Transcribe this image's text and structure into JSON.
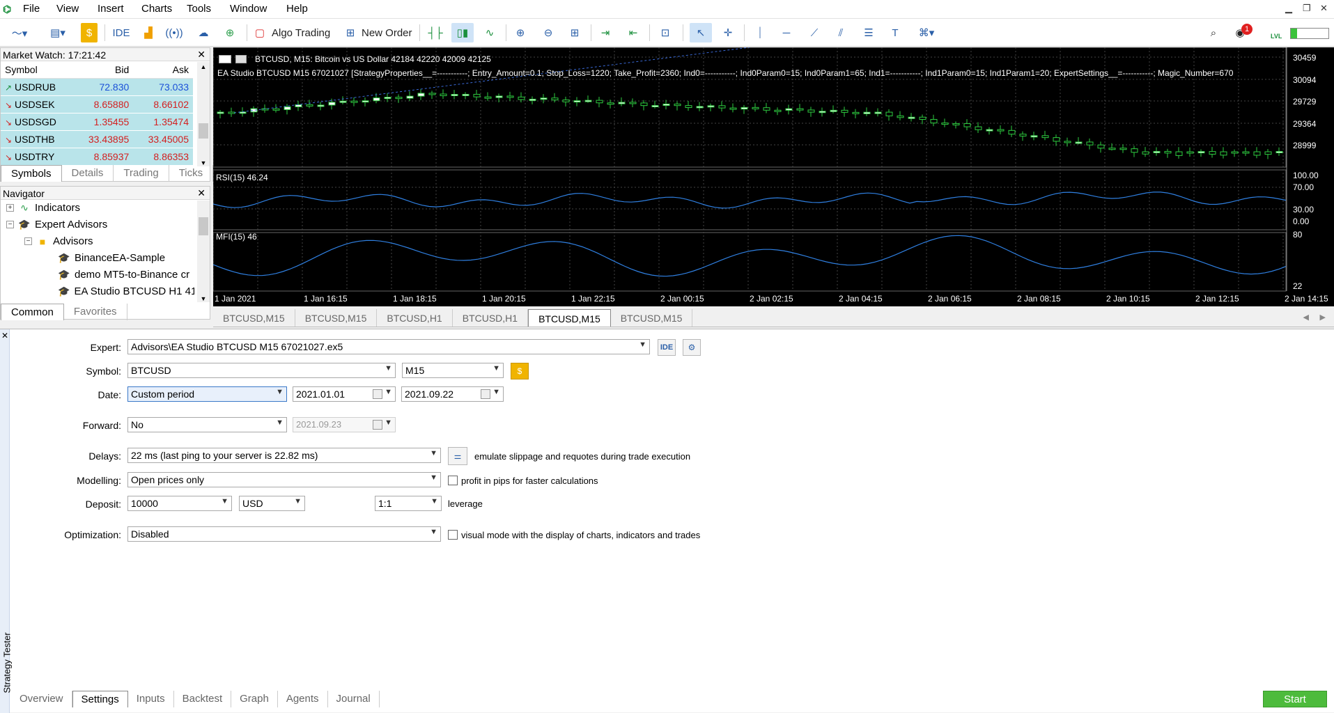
{
  "menu": [
    "File",
    "View",
    "Insert",
    "Charts",
    "Tools",
    "Window",
    "Help"
  ],
  "toolbar": {
    "ide_label": "IDE",
    "algo_trading": "Algo Trading",
    "new_order": "New Order",
    "notification_count": "1",
    "lvl_label": "LVL"
  },
  "market_watch": {
    "title": "Market Watch: 17:21:42",
    "columns": [
      "Symbol",
      "Bid",
      "Ask"
    ],
    "rows": [
      {
        "symbol": "USDRUB",
        "bid": "72.830",
        "ask": "73.033",
        "dir": "up"
      },
      {
        "symbol": "USDSEK",
        "bid": "8.65880",
        "ask": "8.66102",
        "dir": "dn"
      },
      {
        "symbol": "USDSGD",
        "bid": "1.35455",
        "ask": "1.35474",
        "dir": "dn"
      },
      {
        "symbol": "USDTHB",
        "bid": "33.43895",
        "ask": "33.45005",
        "dir": "dn"
      },
      {
        "symbol": "USDTRY",
        "bid": "8.85937",
        "ask": "8.86353",
        "dir": "dn"
      }
    ],
    "tabs": [
      "Symbols",
      "Details",
      "Trading",
      "Ticks"
    ]
  },
  "navigator": {
    "title": "Navigator",
    "items": [
      "Indicators",
      "Expert Advisors",
      "Advisors",
      "BinanceEA-Sample",
      "demo MT5-to-Binance cr",
      "EA Studio BTCUSD H1 41"
    ],
    "tabs": [
      "Common",
      "Favorites"
    ]
  },
  "chart": {
    "symbol_line": "BTCUSD, M15:  Bitcoin vs US Dollar  42184 42220 42009 42125",
    "ea_line": "EA Studio BTCUSD M15 67021027 [StrategyProperties__=-----------; Entry_Amount=0.1; Stop_Loss=1220; Take_Profit=2360; Ind0=-----------; Ind0Param0=15; Ind0Param1=65; Ind1=-----------; Ind1Param0=15; Ind1Param1=20; ExpertSettings__=-----------; Magic_Number=670",
    "rsi_label": "RSI(15) 46.24",
    "mfi_label": "MFI(15) 46",
    "price_ticks": [
      "30459",
      "30094",
      "29729",
      "29364",
      "28999"
    ],
    "rsi_ticks": [
      "100.00",
      "70.00",
      "30.00",
      "0.00"
    ],
    "mfi_ticks": [
      "80",
      "22"
    ],
    "time_ticks": [
      "1 Jan 2021",
      "1 Jan 16:15",
      "1 Jan 18:15",
      "1 Jan 20:15",
      "1 Jan 22:15",
      "2 Jan 00:15",
      "2 Jan 02:15",
      "2 Jan 04:15",
      "2 Jan 06:15",
      "2 Jan 08:15",
      "2 Jan 10:15",
      "2 Jan 12:15",
      "2 Jan 14:15"
    ]
  },
  "chart_tabs": [
    "BTCUSD,M15",
    "BTCUSD,M15",
    "BTCUSD,H1",
    "BTCUSD,H1",
    "BTCUSD,M15",
    "BTCUSD,M15"
  ],
  "tester": {
    "side_title": "Strategy Tester",
    "expert_label": "Expert:",
    "expert_value": "Advisors\\EA Studio BTCUSD M15 67021027.ex5",
    "ide_btn": "IDE",
    "symbol_label": "Symbol:",
    "symbol_value": "BTCUSD",
    "timeframe_value": "M15",
    "date_label": "Date:",
    "date_mode": "Custom period",
    "date_from": "2021.01.01",
    "date_to": "2021.09.22",
    "forward_label": "Forward:",
    "forward_value": "No",
    "forward_date": "2021.09.23",
    "delays_label": "Delays:",
    "delays_value": "22 ms (last ping to your server is 22.82 ms)",
    "delays_note": "emulate slippage and requotes during trade execution",
    "modelling_label": "Modelling:",
    "modelling_value": "Open prices only",
    "pips_note": "profit in pips for faster calculations",
    "deposit_label": "Deposit:",
    "deposit_value": "10000",
    "currency_value": "USD",
    "leverage_value": "1:1",
    "leverage_label": "leverage",
    "optimization_label": "Optimization:",
    "optimization_value": "Disabled",
    "visual_note": "visual mode with the display of charts, indicators and trades",
    "tabs": [
      "Overview",
      "Settings",
      "Inputs",
      "Backtest",
      "Graph",
      "Agents",
      "Journal"
    ],
    "start": "Start"
  }
}
